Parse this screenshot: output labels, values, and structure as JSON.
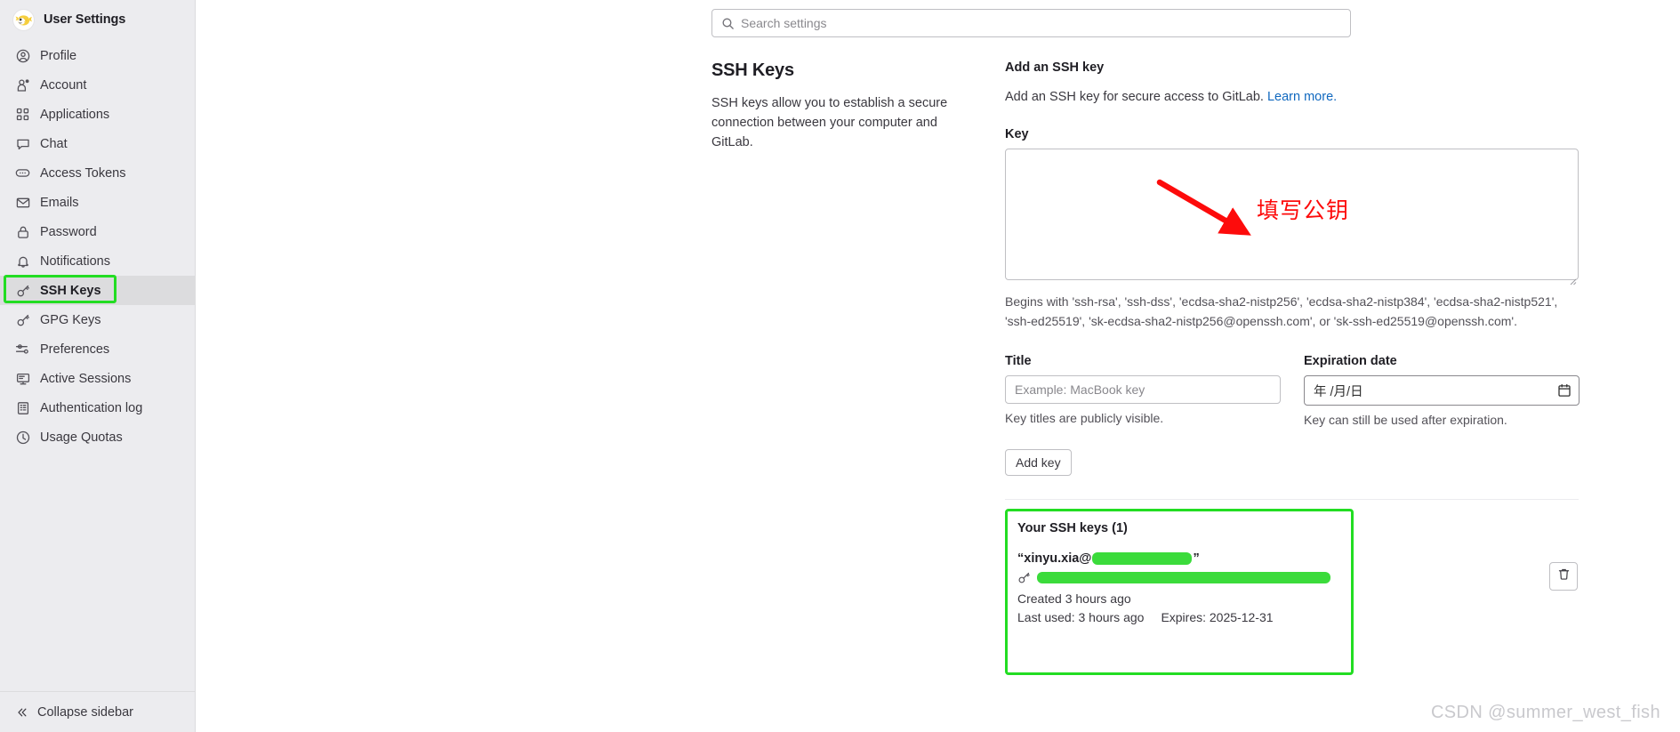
{
  "sidebar": {
    "title": "User Settings",
    "avatar_icon": "pufferfish-avatar",
    "items": [
      {
        "label": "Profile",
        "icon": "user-circle-icon"
      },
      {
        "label": "Account",
        "icon": "account-gear-icon"
      },
      {
        "label": "Applications",
        "icon": "grid-squares-icon"
      },
      {
        "label": "Chat",
        "icon": "speech-bubble-icon"
      },
      {
        "label": "Access Tokens",
        "icon": "token-pill-icon"
      },
      {
        "label": "Emails",
        "icon": "envelope-icon"
      },
      {
        "label": "Password",
        "icon": "lock-icon"
      },
      {
        "label": "Notifications",
        "icon": "bell-icon"
      },
      {
        "label": "SSH Keys",
        "icon": "key-icon"
      },
      {
        "label": "GPG Keys",
        "icon": "key-icon"
      },
      {
        "label": "Preferences",
        "icon": "sliders-icon"
      },
      {
        "label": "Active Sessions",
        "icon": "monitor-icon"
      },
      {
        "label": "Authentication log",
        "icon": "log-list-icon"
      },
      {
        "label": "Usage Quotas",
        "icon": "gauge-clock-icon"
      }
    ],
    "active_item": "SSH Keys",
    "collapse": {
      "label": "Collapse sidebar",
      "icon": "chevron-double-left-icon"
    }
  },
  "search": {
    "placeholder": "Search settings",
    "icon": "search-icon",
    "value": ""
  },
  "page": {
    "heading": "SSH Keys",
    "description": "SSH keys allow you to establish a secure connection between your computer and GitLab."
  },
  "add_key": {
    "section_title": "Add an SSH key",
    "section_desc": "Add an SSH key for secure access to GitLab.",
    "learn_more": "Learn more.",
    "key_label": "Key",
    "key_value": "",
    "key_helper": "Begins with 'ssh-rsa', 'ssh-dss', 'ecdsa-sha2-nistp256', 'ecdsa-sha2-nistp384', 'ecdsa-sha2-nistp521', 'ssh-ed25519', 'sk-ecdsa-sha2-nistp256@openssh.com', or 'sk-ssh-ed25519@openssh.com'.",
    "title_label": "Title",
    "title_placeholder": "Example: MacBook key",
    "title_value": "",
    "title_helper": "Key titles are publicly visible.",
    "expiration_label": "Expiration date",
    "expiration_value": "年 /月/日",
    "expiration_helper": "Key can still be used after expiration.",
    "calendar_icon": "calendar-icon",
    "submit_label": "Add key"
  },
  "your_keys": {
    "heading": "Your SSH keys (1)",
    "count": 1,
    "entries": [
      {
        "title_prefix": "“xinyu.xia@",
        "title_suffix": "”",
        "title_redacted": true,
        "fingerprint_redacted": true,
        "fingerprint_icon": "key-icon",
        "created": "Created 3 hours ago",
        "last_used": "Last used: 3 hours ago",
        "expires": "Expires: 2025-12-31",
        "delete_icon": "trash-icon"
      }
    ]
  },
  "annotations": {
    "arrow_color": "#fd0b0b",
    "box_color": "#22dd22",
    "redaction_color": "#3bdb3b",
    "chinese_note": "填写公钥",
    "arrow_icon": "red-arrow-icon"
  },
  "watermark": "CSDN @summer_west_fish"
}
